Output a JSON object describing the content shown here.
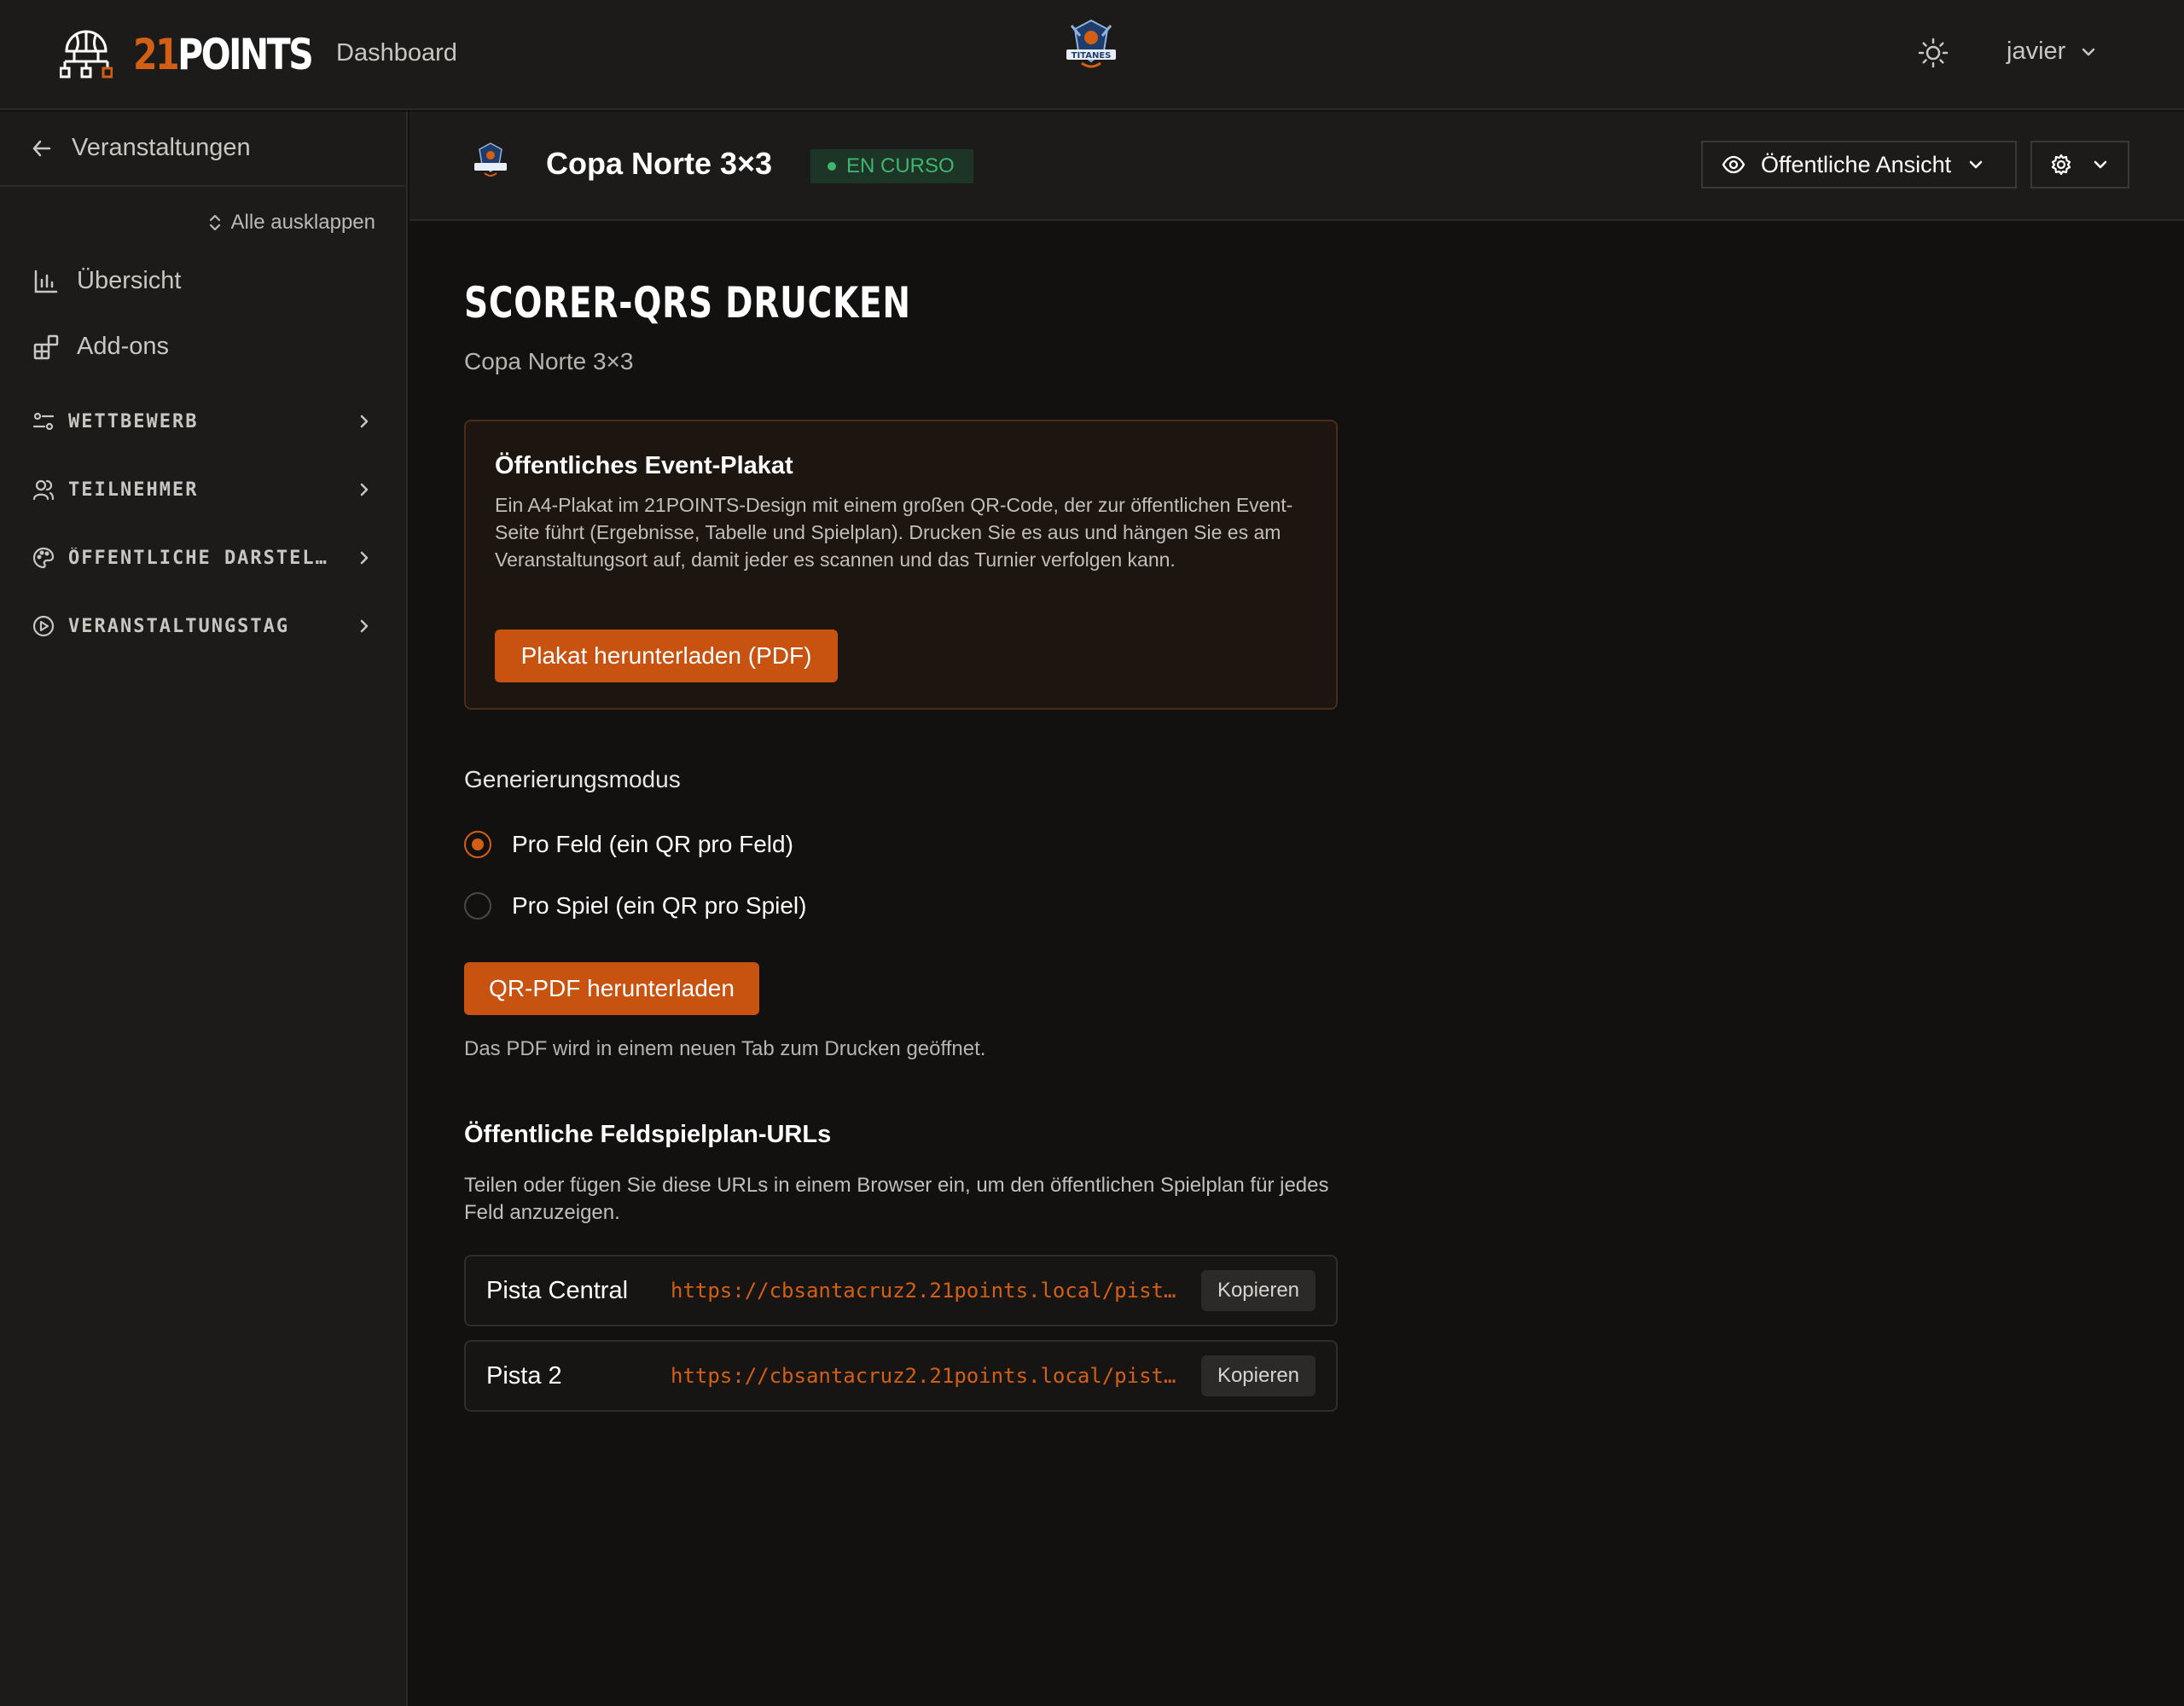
{
  "topbar": {
    "brand_number": "21",
    "brand_text": "POINTS",
    "dashboard_label": "Dashboard",
    "user_name": "javier",
    "icons": {
      "brand": "basketball-bracket-icon",
      "center_logo": "titanes-logo",
      "theme": "sun-icon",
      "user_menu": "chevron-down-icon"
    }
  },
  "sidebar": {
    "back_label": "Veranstaltungen",
    "expand_all_label": "Alle ausklappen",
    "items": [
      {
        "label": "Übersicht",
        "icon": "bar-chart-icon"
      },
      {
        "label": "Add-ons",
        "icon": "grid-plus-icon"
      }
    ],
    "groups": [
      {
        "label": "WETTBEWERB",
        "icon": "sliders-icon"
      },
      {
        "label": "TEILNEHMER",
        "icon": "users-icon"
      },
      {
        "label": "ÖFFENTLICHE DARSTEL…",
        "icon": "palette-icon"
      },
      {
        "label": "VERANSTALTUNGSTAG",
        "icon": "play-circle-icon"
      }
    ]
  },
  "event_header": {
    "title": "Copa Norte 3×3",
    "status": "EN CURSO",
    "public_view_label": "Öffentliche Ansicht"
  },
  "main": {
    "title": "SCORER-QRS DRUCKEN",
    "subtitle": "Copa Norte 3×3",
    "poster": {
      "title": "Öffentliches Event-Plakat",
      "description": "Ein A4-Plakat im 21POINTS-Design mit einem großen QR-Code, der zur öffentlichen Event-Seite führt (Ergebnisse, Tabelle und Spielplan). Drucken Sie es aus und hängen Sie es am Veranstaltungsort auf, damit jeder es scannen und das Turnier verfolgen kann.",
      "button_label": "Plakat herunterladen (PDF)"
    },
    "mode": {
      "label": "Generierungsmodus",
      "options": [
        {
          "label": "Pro Feld (ein QR pro Feld)",
          "selected": true
        },
        {
          "label": "Pro Spiel (ein QR pro Spiel)",
          "selected": false
        }
      ],
      "download_label": "QR-PDF herunterladen",
      "note": "Das PDF wird in einem neuen Tab zum Drucken geöffnet."
    },
    "urls": {
      "title": "Öffentliche Feldspielplan-URLs",
      "description": "Teilen oder fügen Sie diese URLs in einem Browser ein, um den öffentlichen Spielplan für jedes Feld anzuzeigen.",
      "rows": [
        {
          "name": "Pista Central",
          "url": "https://cbsantacruz2.21points.local/pist…",
          "copy_label": "Kopieren"
        },
        {
          "name": "Pista 2",
          "url": "https://cbsantacruz2.21points.local/pist…",
          "copy_label": "Kopieren"
        }
      ]
    }
  },
  "colors": {
    "accent": "#d35f14",
    "status_green": "#3fb56e",
    "background": "#121110",
    "panel": "#1c1b1a"
  }
}
